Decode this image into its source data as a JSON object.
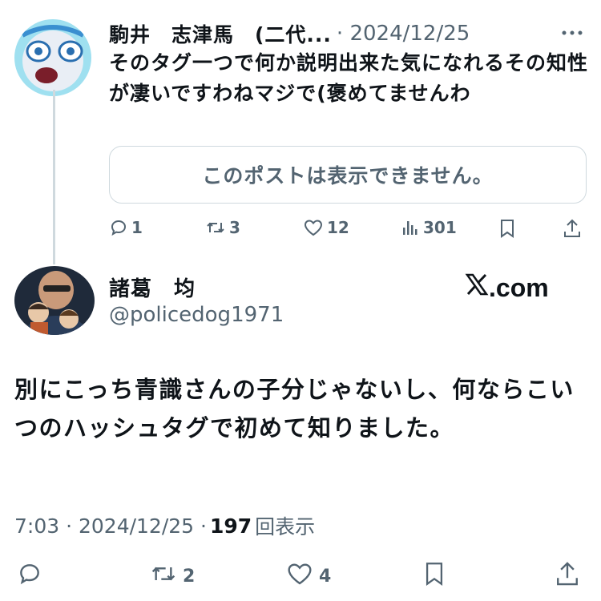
{
  "reply": {
    "author_name": "駒井　志津馬　(二代...",
    "date": "· 2024/12/25",
    "text": "そのタグ一つで何か説明出来た気になれるその知性が凄いですわねマジで(褒めてませんわ",
    "quoted_notice": "このポストは表示できません。",
    "stats": {
      "replies": "1",
      "reposts": "3",
      "likes": "12",
      "views": "301"
    }
  },
  "main": {
    "author_name": "諸葛　均",
    "handle": "@policedog1971",
    "brand_suffix": ".com",
    "text": "別にこっち青識さんの子分じゃないし、何ならこいつのハッシュタグで初めて知りました。",
    "time": "7:03 · 2024/12/25 ·",
    "views_count": "197",
    "views_label": "回表示",
    "stats": {
      "reposts": "2",
      "likes": "4"
    }
  },
  "icons": [
    "more-icon",
    "reply-icon",
    "repost-icon",
    "like-icon",
    "views-icon",
    "bookmark-icon",
    "share-icon",
    "x-logo-icon"
  ]
}
